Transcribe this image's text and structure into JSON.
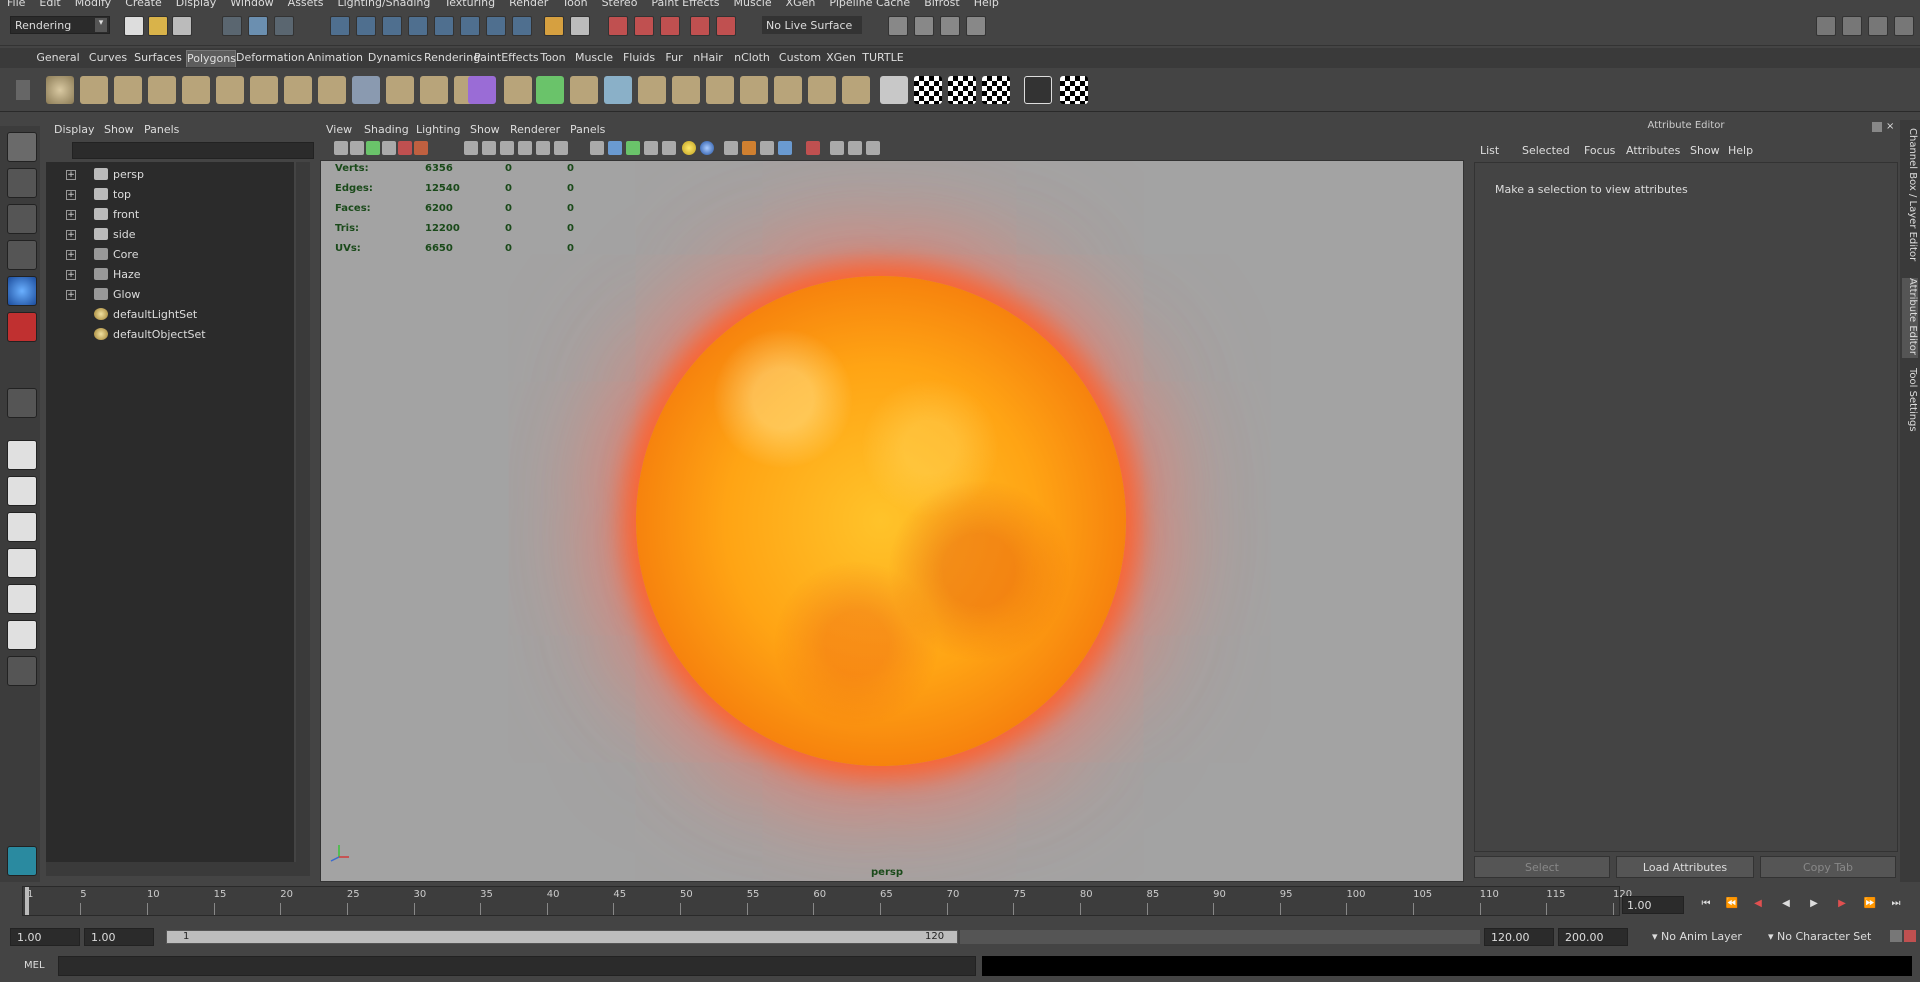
{
  "menubar": [
    "File",
    "Edit",
    "Modify",
    "Create",
    "Display",
    "Window",
    "Assets",
    "Lighting/Shading",
    "Texturing",
    "Render",
    "Toon",
    "Stereo",
    "Paint Effects",
    "Muscle",
    "XGen",
    "Pipeline Cache",
    "Bifrost",
    "Help"
  ],
  "status": {
    "menuset": "Rendering",
    "live_surface": "No Live Surface"
  },
  "shelf": {
    "tabs": [
      "General",
      "Curves",
      "Surfaces",
      "Polygons",
      "Deformation",
      "Animation",
      "Dynamics",
      "Rendering",
      "PaintEffects",
      "Toon",
      "Muscle",
      "Fluids",
      "Fur",
      "nHair",
      "nCloth",
      "Custom",
      "XGen",
      "TURTLE"
    ],
    "active_tab": "Polygons"
  },
  "outliner": {
    "menu": [
      "Display",
      "Show",
      "Panels"
    ],
    "items": [
      {
        "label": "persp",
        "icon": "camera-icon",
        "expandable": true
      },
      {
        "label": "top",
        "icon": "camera-icon",
        "expandable": true
      },
      {
        "label": "front",
        "icon": "camera-icon",
        "expandable": true
      },
      {
        "label": "side",
        "icon": "camera-icon",
        "expandable": true
      },
      {
        "label": "Core",
        "icon": "group-icon",
        "expandable": true
      },
      {
        "label": "Haze",
        "icon": "group-icon",
        "expandable": true
      },
      {
        "label": "Glow",
        "icon": "group-icon",
        "expandable": true
      },
      {
        "label": "defaultLightSet",
        "icon": "set-icon",
        "expandable": false
      },
      {
        "label": "defaultObjectSet",
        "icon": "set-icon",
        "expandable": false
      }
    ]
  },
  "viewport": {
    "menu": [
      "View",
      "Shading",
      "Lighting",
      "Show",
      "Renderer",
      "Panels"
    ],
    "hud": [
      {
        "label": "Verts:",
        "v1": "6356",
        "v2": "0",
        "v3": "0"
      },
      {
        "label": "Edges:",
        "v1": "12540",
        "v2": "0",
        "v3": "0"
      },
      {
        "label": "Faces:",
        "v1": "6200",
        "v2": "0",
        "v3": "0"
      },
      {
        "label": "Tris:",
        "v1": "12200",
        "v2": "0",
        "v3": "0"
      },
      {
        "label": "UVs:",
        "v1": "6650",
        "v2": "0",
        "v3": "0"
      }
    ],
    "camera": "persp"
  },
  "attribute_editor": {
    "title": "Attribute Editor",
    "menu": [
      "List",
      "Selected",
      "Focus",
      "Attributes",
      "Show",
      "Help"
    ],
    "message": "Make a selection to view attributes",
    "buttons": {
      "select": "Select",
      "load": "Load Attributes",
      "copy": "Copy Tab"
    }
  },
  "side_tabs": [
    "Channel Box / Layer Editor",
    "Attribute Editor",
    "Tool Settings"
  ],
  "timeslider": {
    "ticks": [
      "1",
      "5",
      "10",
      "15",
      "20",
      "25",
      "30",
      "35",
      "40",
      "45",
      "50",
      "55",
      "60",
      "65",
      "70",
      "75",
      "80",
      "85",
      "90",
      "95",
      "100",
      "105",
      "110",
      "115",
      "120"
    ],
    "current": "1.00"
  },
  "range": {
    "start": "1.00",
    "playback_start": "1.00",
    "slider_start": "1",
    "slider_end": "120",
    "playback_end": "120.00",
    "end": "200.00",
    "anim_layer": "No Anim Layer",
    "char_set": "No Character Set"
  },
  "mel": {
    "label": "MEL"
  }
}
